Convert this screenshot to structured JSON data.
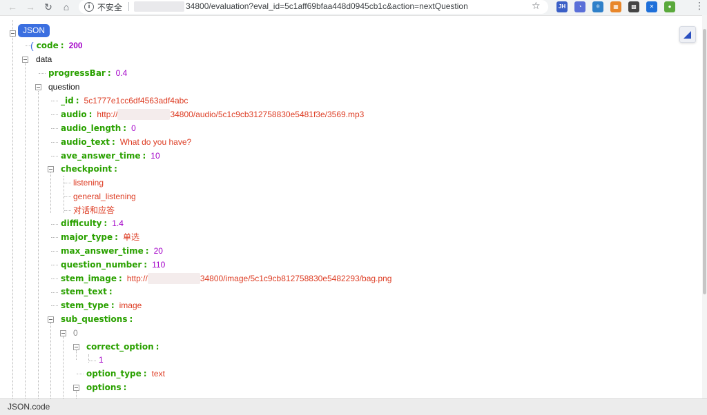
{
  "browser": {
    "back_icon": "arrow-left-icon",
    "forward_icon": "arrow-right-icon",
    "reload_icon": "reload-icon",
    "home_icon": "home-icon",
    "security_label": "不安全",
    "url": "34800/evaluation?eval_id=5c1aff69bfaa448d0945cb1c&action=nextQuestion",
    "extensions": [
      {
        "label": "JH",
        "color": "#3b5fc6"
      },
      {
        "label": "◔",
        "color": "#5a6fd8"
      },
      {
        "label": "⚛",
        "color": "#2f80c9"
      },
      {
        "label": "▦",
        "color": "#e8862a"
      },
      {
        "label": "▩",
        "color": "#444444"
      },
      {
        "label": "✕",
        "color": "#1e6fd9"
      },
      {
        "label": "●",
        "color": "#5aa93c"
      }
    ]
  },
  "tree": {
    "root_label": "JSON",
    "code": {
      "key": "code",
      "value": "200"
    },
    "data": {
      "key": "data",
      "progressBar": {
        "key": "progressBar",
        "value": "0.4"
      },
      "question": {
        "key": "question",
        "id": {
          "key": "_id",
          "value": "5c1777e1cc6df4563adf4abc"
        },
        "audio": {
          "key": "audio",
          "prefix": "http://",
          "value": "34800/audio/5c1c9cb312758830e5481f3e/3569.mp3"
        },
        "audio_length": {
          "key": "audio_length",
          "value": "0"
        },
        "audio_text": {
          "key": "audio_text",
          "value": "What do you have?"
        },
        "ave_answer_time": {
          "key": "ave_answer_time",
          "value": "10"
        },
        "checkpoint": {
          "key": "checkpoint",
          "items": [
            "listening",
            "general_listening",
            "对话和应答"
          ]
        },
        "difficulty": {
          "key": "difficulty",
          "value": "1.4"
        },
        "major_type": {
          "key": "major_type",
          "value": "单选"
        },
        "max_answer_time": {
          "key": "max_answer_time",
          "value": "20"
        },
        "question_number": {
          "key": "question_number",
          "value": "110"
        },
        "stem_image": {
          "key": "stem_image",
          "prefix": "http://",
          "value": "34800/image/5c1c9cb812758830e5482293/bag.png"
        },
        "stem_text": {
          "key": "stem_text",
          "value": ""
        },
        "stem_type": {
          "key": "stem_type",
          "value": "image"
        },
        "sub_questions": {
          "key": "sub_questions",
          "index": "0",
          "correct_option": {
            "key": "correct_option",
            "items": [
              "1"
            ]
          },
          "option_type": {
            "key": "option_type",
            "value": "text"
          },
          "options": {
            "key": "options"
          }
        }
      }
    }
  },
  "status": {
    "path": "JSON.code"
  },
  "colors": {
    "key": "#2aa100",
    "string": "#dd3b22",
    "number": "#a300c8",
    "badge": "#3b6fe0"
  }
}
